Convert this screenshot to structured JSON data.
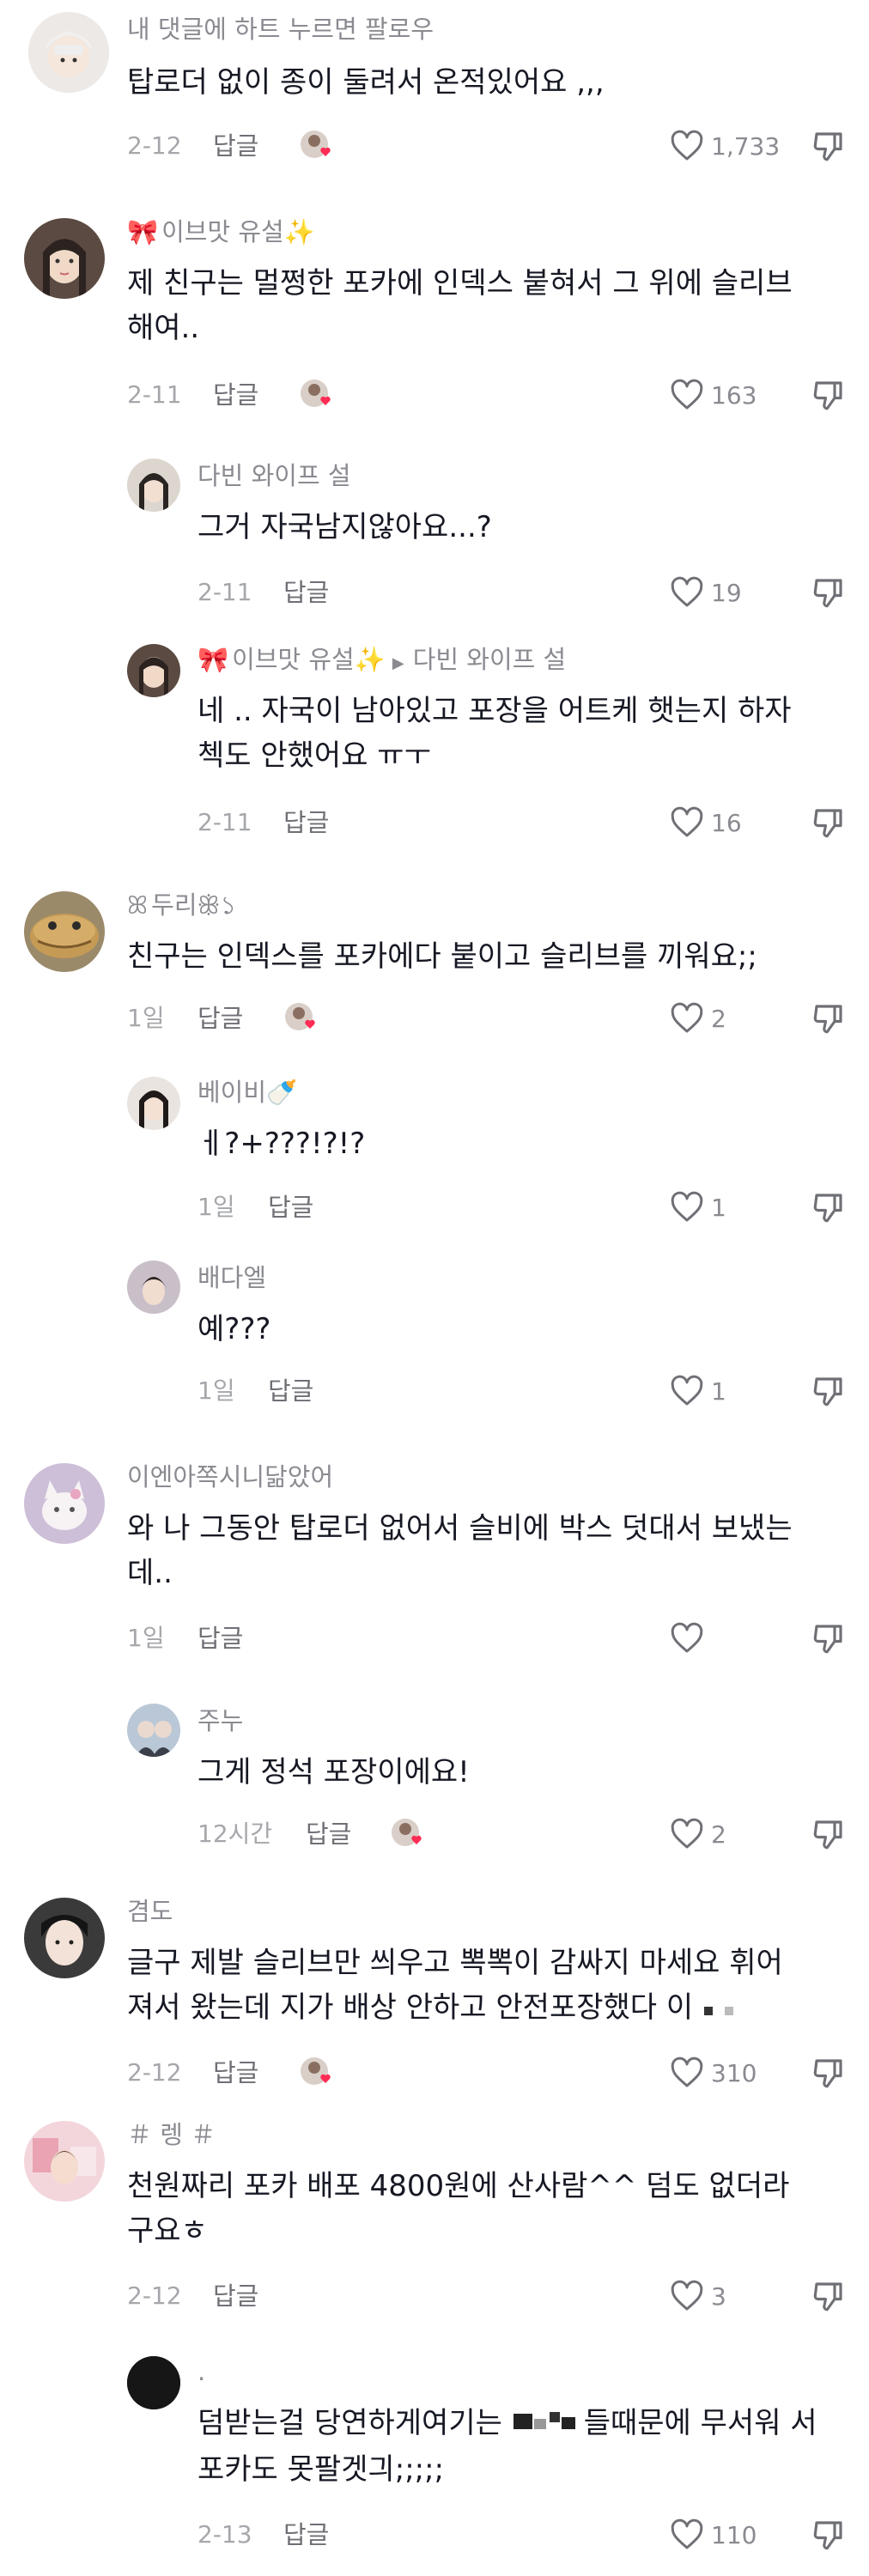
{
  "reply_label": "답글",
  "colors": {
    "primary_text": "#161823",
    "secondary_text": "#8a8b91",
    "accent_heart": "#fe2c55"
  },
  "comments": [
    {
      "id": "c1",
      "username": "내 댓글에 하트 누르면 팔로우",
      "text": "탑로더 없이 종이 둘려서 온적있어요 ,,,",
      "date": "2-12",
      "likes": "1,733",
      "creator_liked": true
    },
    {
      "id": "c2",
      "username": "이브맛 유설",
      "username_deco": "🎀",
      "username_suffix": "✨",
      "text": "제 친구는 멀쩡한 포카에 인덱스 붙혀서 그 위에 슬리브 해여..",
      "date": "2-11",
      "likes": "163",
      "creator_liked": true
    },
    {
      "id": "c3",
      "username": "다빈 와이프 설",
      "text": "그거 자국남지않아요...?",
      "date": "2-11",
      "likes": "19",
      "reply": true
    },
    {
      "id": "c4",
      "username": "이브맛 유설",
      "username_deco": "🎀",
      "username_suffix": "✨",
      "reply_to": "다빈 와이프 설",
      "text": "네 .. 자국이 남아있고 포장을 어트케 햇는지 하자 첵도 안했어요 ㅠㅜ",
      "date": "2-11",
      "likes": "16",
      "reply": true
    },
    {
      "id": "c5",
      "username": "두리",
      "username_deco": "ꕤ",
      "username_suffix": "ꕥ১",
      "text": "친구는 인덱스를 포카에다 붙이고 슬리브를 끼워요;;",
      "date": "1일",
      "likes": "2",
      "creator_liked": true
    },
    {
      "id": "c6",
      "username": "베이비",
      "username_suffix": "🍼",
      "text": "ㅔ?+???!?!?",
      "date": "1일",
      "likes": "1",
      "reply": true
    },
    {
      "id": "c7",
      "username": "배다엘",
      "text": "예???",
      "date": "1일",
      "likes": "1",
      "reply": true
    },
    {
      "id": "c8",
      "username": "이엔아쪽시니닮았어",
      "text": "와 나 그동안 탑로더 없어서 슬비에 박스 덧대서 보냈는 데..",
      "date": "1일",
      "likes": ""
    },
    {
      "id": "c9",
      "username": "주누",
      "text": "그게 정석 포장이에요!",
      "date": "12시간",
      "likes": "2",
      "reply": true,
      "creator_liked": true
    },
    {
      "id": "c10",
      "username": "겸도",
      "text": "글구 제발 슬리브만 씌우고 뽁뽁이 감싸지 마세요 휘어 져서 왔는데 지가 배상 안하고 안전포장했다 이",
      "date": "2-12",
      "likes": "310",
      "creator_liked": true
    },
    {
      "id": "c11",
      "username": "＃ 렝 ＃",
      "text": "천원짜리 포카 배포 4800원에 산사람^^ 덤도 없더라 구요ㅎ",
      "date": "2-12",
      "likes": "3"
    },
    {
      "id": "c12",
      "username": ".",
      "text_before": "덤받는걸 당연하게여기는 ",
      "text_after": "들때문에 무서워 서 포카도 못팔겟긔;;;;;",
      "date": "2-13",
      "likes": "110",
      "reply": true
    }
  ]
}
